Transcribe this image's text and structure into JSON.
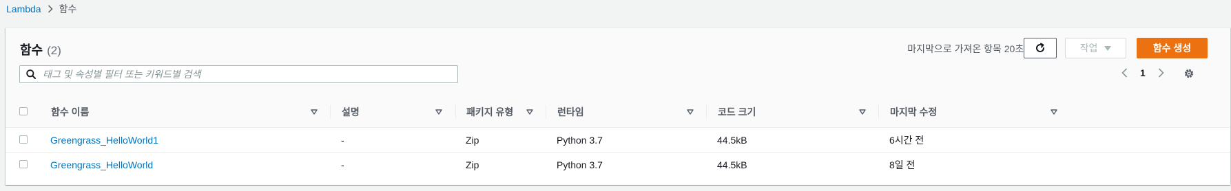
{
  "breadcrumb": {
    "items": [
      {
        "label": "Lambda",
        "link": true
      },
      {
        "label": "함수",
        "link": false
      }
    ]
  },
  "panel": {
    "title": "함수",
    "count": "(2)",
    "last_fetched": "마지막으로 가져온 항목 20초 전",
    "actions_label": "작업",
    "create_label": "함수 생성"
  },
  "search": {
    "placeholder": "태그 및 속성별 필터 또는 키워드별 검색",
    "value": ""
  },
  "pagination": {
    "current_page": "1"
  },
  "table": {
    "columns": [
      "함수 이름",
      "설명",
      "패키지 유형",
      "런타임",
      "코드 크기",
      "마지막 수정"
    ],
    "rows": [
      {
        "name": "Greengrass_HelloWorld1",
        "description": "-",
        "package_type": "Zip",
        "runtime": "Python 3.7",
        "code_size": "44.5kB",
        "last_modified": "6시간 전"
      },
      {
        "name": "Greengrass_HelloWorld",
        "description": "-",
        "package_type": "Zip",
        "runtime": "Python 3.7",
        "code_size": "44.5kB",
        "last_modified": "8일 전"
      }
    ]
  },
  "colors": {
    "link": "#0073bb",
    "primary_button": "#ec7211",
    "background": "#f2f3f3"
  },
  "icons": [
    "chevron-right-icon",
    "refresh-icon",
    "caret-down-icon",
    "search-icon",
    "chevron-left-icon",
    "gear-icon",
    "sort-icon"
  ]
}
